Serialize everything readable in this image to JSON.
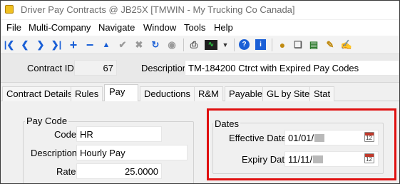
{
  "window": {
    "title": "Driver Pay Contracts @ JB25X [TMWIN - My Trucking Co Canada]"
  },
  "menu": [
    "File",
    "Multi-Company",
    "Navigate",
    "Window",
    "Tools",
    "Help"
  ],
  "toolbar": {
    "icons": [
      "first-record",
      "previous-record",
      "next-record",
      "last-record",
      "add",
      "remove",
      "up",
      "accept",
      "cancel",
      "refresh",
      "binoculars",
      "print",
      "monitor",
      "dropdown",
      "help",
      "info",
      "money-bag",
      "copy",
      "notes",
      "edit-note",
      "sign"
    ]
  },
  "header": {
    "contract_id_label": "Contract ID",
    "contract_id_value": "67",
    "description_label": "Description",
    "description_value": "TM-184200 Ctrct with Expired Pay Codes"
  },
  "tabs": [
    "Contract Details",
    "Rules",
    "Pay",
    "Deductions",
    "R&M",
    "Payable",
    "GL by Site",
    "Stat"
  ],
  "active_tab": "Pay",
  "pay_code": {
    "group_title": "Pay Code",
    "code_label": "Code",
    "code_value": "HR",
    "description_label": "Description",
    "description_value": "Hourly Pay",
    "rate_label": "Rate",
    "rate_value": "25.0000"
  },
  "dates": {
    "group_title": "Dates",
    "effective_label": "Effective Dates",
    "effective_value": "01/01/",
    "expiry_label": "Expiry Date",
    "expiry_value": "11/11/"
  },
  "colors": {
    "highlight": "#e01010",
    "toolbar_icon": "#1a5fd6"
  }
}
